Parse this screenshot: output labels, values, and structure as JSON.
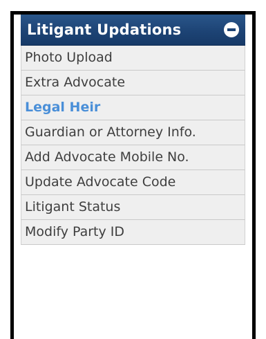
{
  "panel": {
    "title": "Litigant Updations",
    "collapse_icon": "minus-circle-icon",
    "items": [
      {
        "label": "Photo Upload",
        "active": false
      },
      {
        "label": "Extra Advocate",
        "active": false
      },
      {
        "label": "Legal Heir",
        "active": true
      },
      {
        "label": "Guardian or Attorney Info.",
        "active": false
      },
      {
        "label": "Add Advocate Mobile No.",
        "active": false
      },
      {
        "label": "Update Advocate Code",
        "active": false
      },
      {
        "label": "Litigant Status",
        "active": false
      },
      {
        "label": "Modify Party ID",
        "active": false
      }
    ]
  },
  "colors": {
    "header_bg": "#1c4273",
    "active_text": "#4a8fd8",
    "item_bg": "#efefef"
  }
}
